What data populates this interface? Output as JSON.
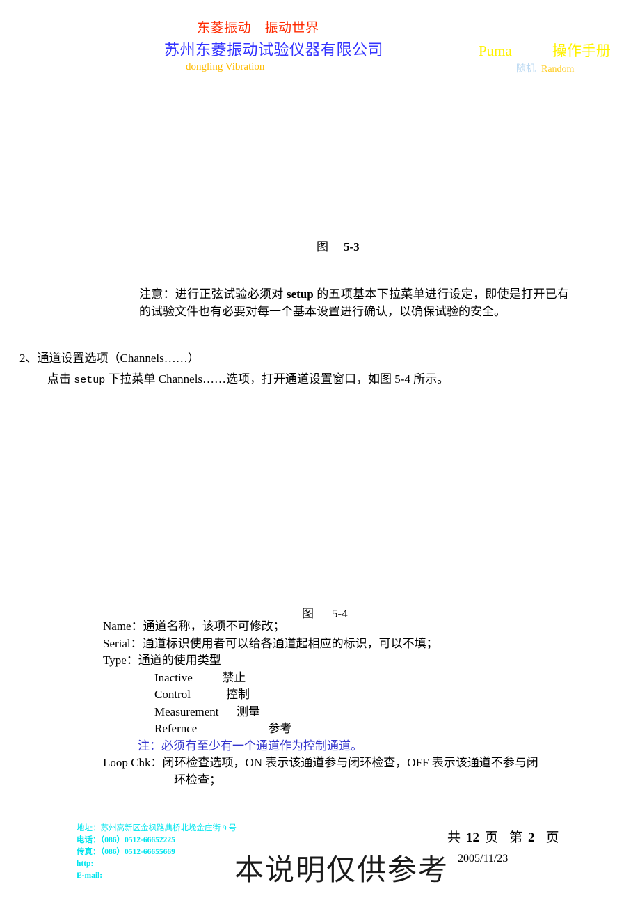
{
  "header": {
    "slogan": "东菱振动　振动世界",
    "company_cn": "苏州东菱振动试验仪器有限公司",
    "company_en": "dongling Vibration",
    "product": "Puma",
    "manual_label": "操作手册",
    "mode_cn": "随机",
    "mode_en": "Random",
    "colors": {
      "slogan": "#FF2A00",
      "company_cn": "#3333FF",
      "company_en": "#FFBB00",
      "product": "#FFF200",
      "mode_cn": "#BBD9F2",
      "mode_en": "#FFCC22"
    }
  },
  "figures": {
    "fig_53_label": "图",
    "fig_53_number": "5-3",
    "fig_54_label": "图",
    "fig_54_number": "5-4"
  },
  "note": {
    "prefix": "注意：进行正弦试验必须对 ",
    "keyword": "setup",
    "suffix": " 的五项基本下拉菜单进行设定，即使是打开已有的试验文件也有必要对每一个基本设置进行确认，以确保试验的安全。"
  },
  "section": {
    "title": "2、通道设置选项（Channels……）",
    "body_before": "点击 ",
    "body_setup": "setup",
    "body_middle": " 下拉菜单 ",
    "body_channels": "Channels……",
    "body_after": "选项，打开通道设置窗口，如图 5-4 所示。"
  },
  "definitions": {
    "name": "Name：通道名称，该项不可修改；",
    "serial": "Serial：通道标识使用者可以给各通道起相应的标识，可以不填；",
    "type": "Type：通道的使用类型",
    "type_options": [
      "Inactive          禁止",
      "Control            控制",
      "Measurement      测量",
      "Refernce                        参考"
    ],
    "type_note": "注：必须有至少有一个通道作为控制通道。",
    "loop_chk_label": "Loop Chk：",
    "loop_chk_text": "闭环检查选项，ON 表示该通道参与闭环检查，OFF 表示该通道不参与闭",
    "loop_chk_cont": "环检查；",
    "type_note_color": "#3333CC"
  },
  "footer": {
    "address": "地址：苏州高新区金枫路典桥北堍金庄街 9 号",
    "phone": "电话：（086）0512-66652225",
    "fax": "传真：（086）0512-66655669",
    "http": "http:",
    "email": "E-mail:",
    "color": "#00E5EE",
    "watermark": "本说明仅供参考",
    "page_total_label": "共",
    "page_total": "12",
    "page_unit": "页",
    "page_current_label": "第",
    "page_current": "2",
    "page_current_unit": "页",
    "date": "2005/11/23"
  }
}
